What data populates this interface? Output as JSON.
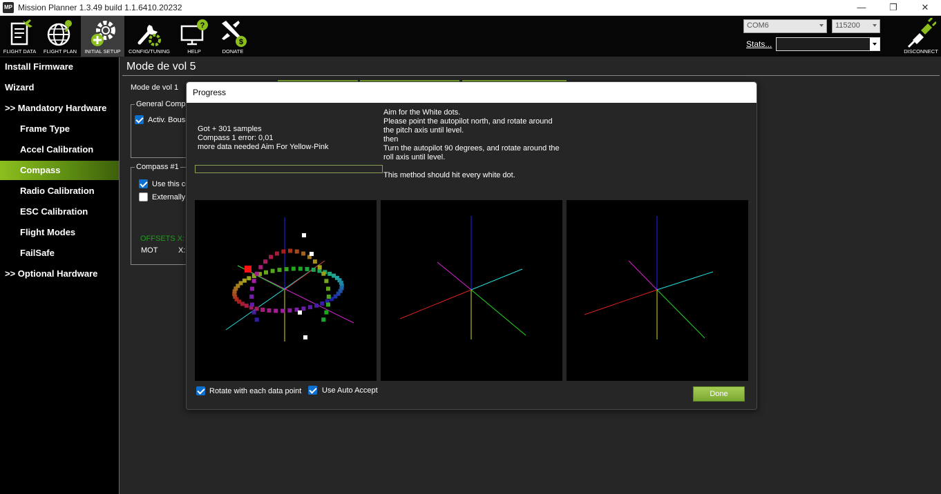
{
  "window": {
    "app_icon": "MP",
    "title": "Mission Planner 1.3.49 build 1.1.6410.20232",
    "minimize_glyph": "—",
    "restore_glyph": "❐",
    "close_glyph": "✕"
  },
  "toolbar": {
    "buttons": [
      {
        "label": "FLIGHT DATA",
        "icon": "flight-data-icon"
      },
      {
        "label": "FLIGHT PLAN",
        "icon": "flight-plan-icon"
      },
      {
        "label": "INITIAL SETUP",
        "icon": "initial-setup-icon"
      },
      {
        "label": "CONFIG/TUNING",
        "icon": "config-tuning-icon"
      },
      {
        "label": "HELP",
        "icon": "help-icon"
      },
      {
        "label": "DONATE",
        "icon": "donate-icon"
      }
    ],
    "active": "INITIAL SETUP",
    "port": "COM6",
    "baud": "115200",
    "stats_label": "Stats...",
    "stats_value": "",
    "disconnect_label": "DISCONNECT"
  },
  "sidebar": {
    "items": [
      {
        "label": "Install Firmware",
        "level": 0
      },
      {
        "label": "Wizard",
        "level": 0
      },
      {
        "label": ">> Mandatory Hardware",
        "level": 0
      },
      {
        "label": "Frame Type",
        "level": 1
      },
      {
        "label": "Accel Calibration",
        "level": 1
      },
      {
        "label": "Compass",
        "level": 1,
        "active": true
      },
      {
        "label": "Radio Calibration",
        "level": 1
      },
      {
        "label": "ESC Calibration",
        "level": 1
      },
      {
        "label": "Flight Modes",
        "level": 1
      },
      {
        "label": "FailSafe",
        "level": 1
      },
      {
        "label": ">> Optional Hardware",
        "level": 0
      }
    ]
  },
  "page": {
    "title": "Mode de vol 5",
    "mode_label": "Mode de vol 1",
    "general_group": "General Compa",
    "enable_compass": "Activ. Bouss",
    "compass1_group": "Compass #1",
    "use_this_compass": "Use this co",
    "externally_mounted": "Externally m",
    "offsets": "OFFSETS  X:",
    "mot": "MOT",
    "mot_x": "X:"
  },
  "dialog": {
    "title": "Progress",
    "status": "Got + 301 samples\nCompass 1 error: 0,01\nmore data needed Aim For Yellow-Pink",
    "instructions": "Aim for the White dots.\nPlease point the autopilot north, and rotate around\nthe pitch axis until level.\nthen\nTurn the autopilot 90 degrees, and rotate around the\nroll axis until level.\n\nThis method should hit every white dot.",
    "progress_fraction": 0.0,
    "rotate_label": "Rotate with each data point",
    "rotate_checked": true,
    "auto_accept_label": "Use Auto Accept",
    "auto_accept_checked": true,
    "done_label": "Done"
  },
  "colors": {
    "accent_green": "#8cbf1e",
    "offsets_green": "#1e9c1e",
    "toolbar_bg": "#060606",
    "panel_bg": "#262626"
  }
}
